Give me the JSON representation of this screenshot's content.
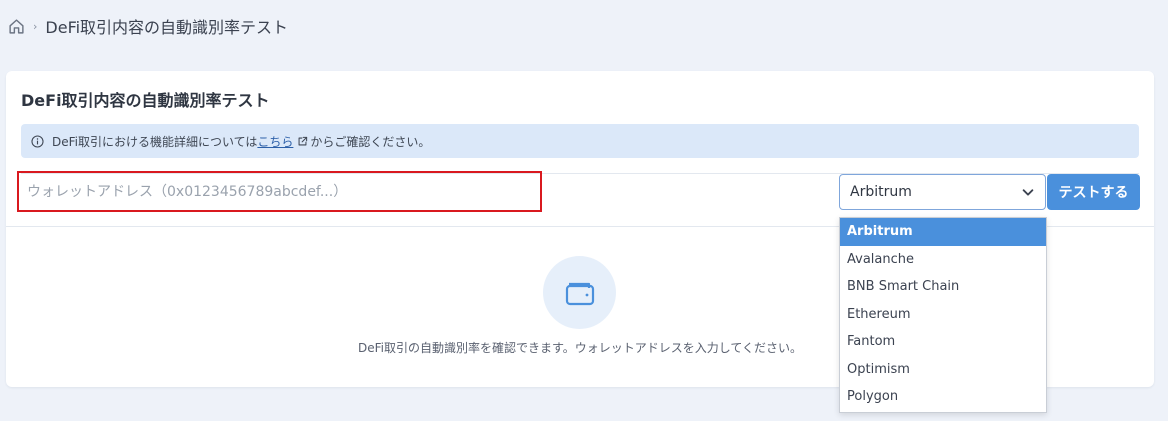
{
  "breadcrumb": {
    "current": "DeFi取引内容の自動識別率テスト"
  },
  "card": {
    "title": "DeFi取引内容の自動識別率テスト"
  },
  "info": {
    "prefix": "DeFi取引における機能詳細については",
    "link_label": "こちら",
    "suffix": "からご確認ください。"
  },
  "address": {
    "placeholder": "ウォレットアドレス（0x0123456789abcdef...）",
    "value": ""
  },
  "chain_select": {
    "selected": "Arbitrum",
    "options": [
      "Arbitrum",
      "Avalanche",
      "BNB Smart Chain",
      "Ethereum",
      "Fantom",
      "Optimism",
      "Polygon"
    ]
  },
  "test_button": {
    "label": "テストする"
  },
  "empty_state": {
    "message": "DeFi取引の自動識別率を確認できます。ウォレットアドレスを入力してください。"
  },
  "colors": {
    "accent": "#4a90dc",
    "highlight_border": "#d9191f",
    "info_bg": "#dbe8f9"
  }
}
